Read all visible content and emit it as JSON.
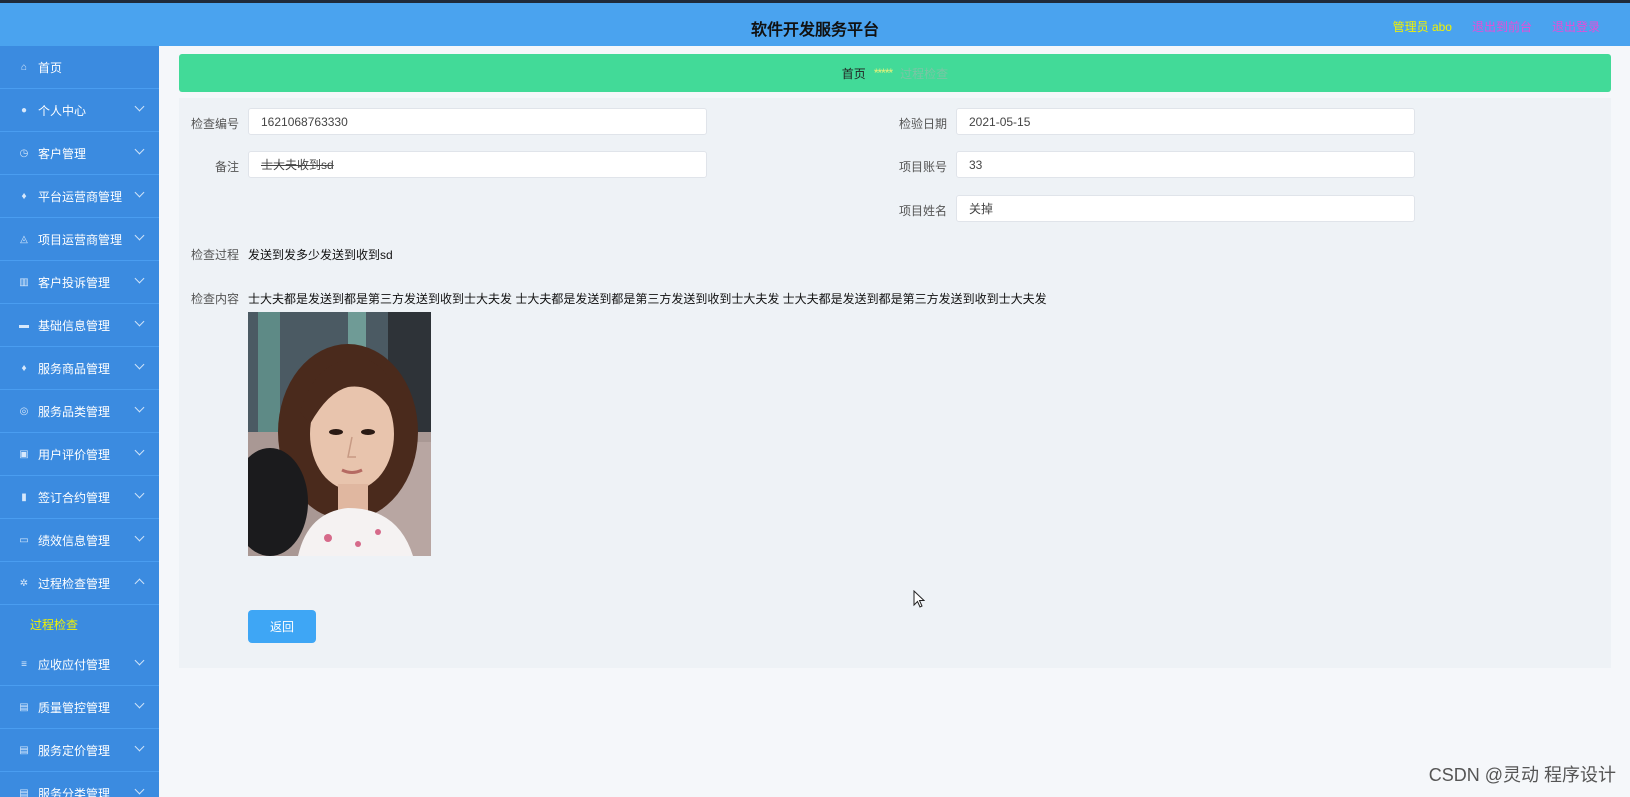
{
  "header": {
    "title": "软件开发服务平台",
    "user": "管理员 abo",
    "to_frontend": "退出到前台",
    "logout": "退出登录"
  },
  "sidebar": {
    "items": [
      {
        "label": "首页",
        "icon": "home-icon",
        "expand": false
      },
      {
        "label": "个人中心",
        "icon": "user-icon",
        "expand": true
      },
      {
        "label": "客户管理",
        "icon": "clock-icon",
        "expand": true
      },
      {
        "label": "平台运营商管理",
        "icon": "pin-icon",
        "expand": true
      },
      {
        "label": "项目运营商管理",
        "icon": "bell-icon",
        "expand": true
      },
      {
        "label": "客户投诉管理",
        "icon": "columns-icon",
        "expand": true
      },
      {
        "label": "基础信息管理",
        "icon": "monitor-icon",
        "expand": true
      },
      {
        "label": "服务商品管理",
        "icon": "pin-icon",
        "expand": true
      },
      {
        "label": "服务品类管理",
        "icon": "compass-icon",
        "expand": true
      },
      {
        "label": "用户评价管理",
        "icon": "check-square-icon",
        "expand": true
      },
      {
        "label": "签订合约管理",
        "icon": "bar-chart-icon",
        "expand": true
      },
      {
        "label": "绩效信息管理",
        "icon": "comment-icon",
        "expand": true
      },
      {
        "label": "过程检查管理",
        "icon": "aperture-icon",
        "expand": true,
        "open": true
      }
    ],
    "sub_item": "过程检查",
    "items_after": [
      {
        "label": "应收应付管理",
        "icon": "sliders-icon"
      },
      {
        "label": "质量管控管理",
        "icon": "briefcase-icon"
      },
      {
        "label": "服务定价管理",
        "icon": "briefcase-icon"
      },
      {
        "label": "服务分类管理",
        "icon": "briefcase-icon"
      }
    ]
  },
  "breadcrumb": {
    "home": "首页",
    "sep": "*****",
    "current": "过程检查"
  },
  "form": {
    "check_no_label": "检查编号",
    "check_no": "1621068763330",
    "remark_label": "备注",
    "remark": "士大夫收到sd",
    "check_date_label": "检验日期",
    "check_date": "2021-05-15",
    "project_account_label": "项目账号",
    "project_account": "33",
    "project_name_label": "项目姓名",
    "project_name": "关掉",
    "process_label": "检查过程",
    "process": "发送到发多少发送到收到sd",
    "content_label": "检查内容",
    "content": "士大夫都是发送到都是第三方发送到收到士大夫发 士大夫都是发送到都是第三方发送到收到士大夫发 士大夫都是发送到都是第三方发送到收到士大夫发",
    "back_button": "返回"
  },
  "watermark": "CSDN @灵动 程序设计"
}
